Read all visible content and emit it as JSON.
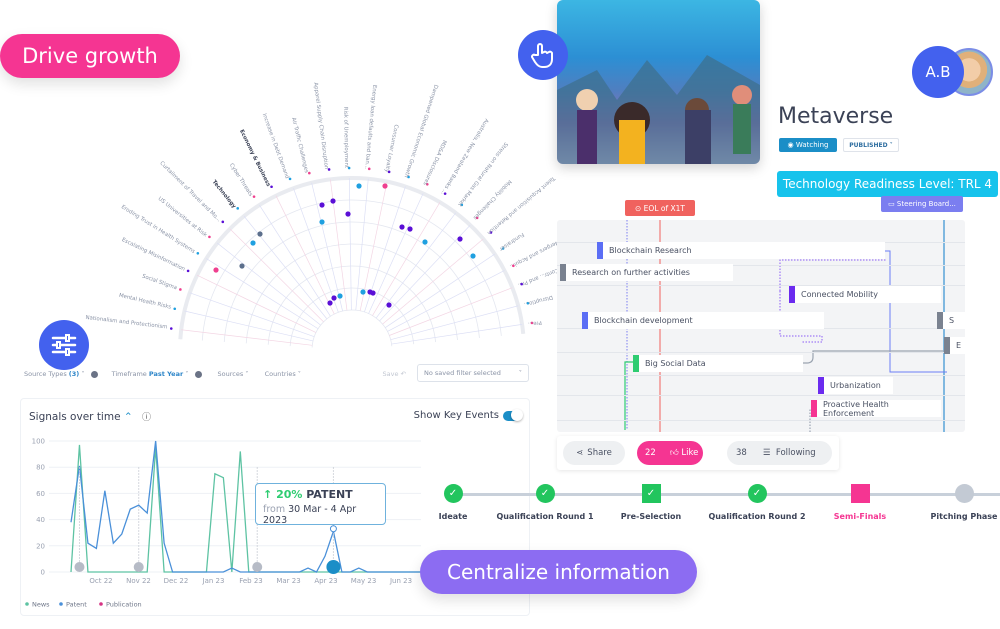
{
  "hero_labels": {
    "drive_growth": "Drive growth",
    "centralize_information": "Centralize information"
  },
  "icons": {
    "hand_pointer": "hand-pointer-icon",
    "sliders": "sliders-icon"
  },
  "radar": {
    "categories": [
      {
        "label": "Technology",
        "bold": true
      },
      {
        "label": "Economy & Business",
        "bold": true
      }
    ],
    "spokes": [
      "Nationalism and Protectionism",
      "Mental Health Risks",
      "Social Stigma",
      "Escalating Misinformation",
      "Eroding Trust in Health Systems",
      "US Universities at Risk",
      "Curtailment of Travel and Mo...",
      "Technology",
      "Cyber Threats",
      "Economy & Business",
      "Increase in Debt Demand",
      "Air Traffic Challenges",
      "Apparel Supply Chain Disruption",
      "Risk of Unemployment",
      "Energy loan defaults and ban...",
      "Consumer Loyalty",
      "Dampened Global Economic Growth",
      "MD&A Disclosures",
      "Australia, New Zealand Banks ...",
      "Stress on Natural Gas Market",
      "Mobility Challenges",
      "Talent Acquisition and Retention",
      "Fundraiser",
      "Hindered Mergers and Acqui...",
      "Cancelled Contr... and Pr...",
      "Disruptio...",
      "Pre..."
    ],
    "colors": {
      "purple": "#5a0fd6",
      "blue": "#1fa0e0",
      "pink": "#ef3f8f",
      "slate": "#5c6f8c"
    }
  },
  "filters": {
    "source_types_label": "Source Types",
    "source_types_count": "(3)",
    "timeframe_label": "Timeframe",
    "timeframe_value": "Past Year",
    "sources_label": "Sources",
    "countries_label": "Countries",
    "save_label": "Save",
    "saved_filter_placeholder": "No saved filter selected"
  },
  "signals": {
    "title": "Signals over time",
    "show_key_events_label": "Show Key Events",
    "show_key_events_on": true,
    "tooltip": {
      "change": "20%",
      "series": "PATENT",
      "from_label": "from",
      "range": "30 Mar - 4 Apr 2023"
    }
  },
  "chart_data": {
    "type": "line",
    "title": "Signals over time",
    "xlabel": "",
    "ylabel": "",
    "ylim": [
      0,
      100
    ],
    "yticks": [
      0,
      20,
      40,
      60,
      80,
      100
    ],
    "xtick_labels": [
      "Oct 22",
      "Nov 22",
      "Dec 22",
      "Jan 23",
      "Feb 23",
      "Mar 23",
      "Apr 23",
      "May 23",
      "Jun 23"
    ],
    "grid": true,
    "legend": [
      "News",
      "Patent",
      "Publication"
    ],
    "legend_position": "bottom-left",
    "colors": {
      "News": "#5ec3a3",
      "Patent": "#4a90d9",
      "Publication": "#d63384"
    },
    "x_weeks": [
      0,
      1,
      2,
      3,
      4,
      5,
      6,
      7,
      8,
      9,
      10,
      11,
      12,
      13,
      14,
      15,
      16,
      17,
      18,
      19,
      20,
      21,
      22,
      23,
      24,
      25,
      26,
      27,
      28,
      29,
      30,
      31,
      32,
      33,
      34,
      35,
      36,
      37,
      38,
      39,
      40,
      41,
      42,
      43
    ],
    "series": [
      {
        "name": "News",
        "values": [
          0,
          97,
          0,
          0,
          0,
          0,
          0,
          0,
          0,
          0,
          95,
          0,
          0,
          0,
          0,
          0,
          0,
          75,
          72,
          0,
          92,
          0,
          0,
          0,
          0,
          0,
          0,
          0,
          0,
          0,
          0,
          0,
          0,
          0,
          0,
          0,
          0,
          0,
          0,
          0,
          0,
          0,
          0,
          0
        ]
      },
      {
        "name": "Patent",
        "values": [
          38,
          81,
          22,
          18,
          62,
          22,
          29,
          48,
          51,
          45,
          100,
          22,
          0,
          0,
          0,
          0,
          0,
          0,
          0,
          3,
          0,
          0,
          0,
          0,
          0,
          0,
          0,
          0,
          3,
          0,
          12,
          31,
          0,
          0,
          3,
          0,
          0,
          0,
          0,
          0,
          0,
          0,
          0,
          0
        ]
      },
      {
        "name": "Publication",
        "values": []
      }
    ],
    "key_event_weeks": [
      1,
      8,
      22,
      31
    ]
  },
  "project": {
    "title": "Metaverse",
    "watching_label": "Watching",
    "status_label": "PUBLISHED",
    "trl_label": "Technology Readiness Level: TRL 4",
    "avatar_initials": "A.B"
  },
  "gantt": {
    "milestones": [
      {
        "label": "EOL of X1T",
        "color": "#f0625e"
      },
      {
        "label": "Steering Board...",
        "color": "#7b7ef0"
      }
    ],
    "items": [
      {
        "label": "Blockchain Research",
        "color": "#5b6ef5"
      },
      {
        "label": "Research on further activities",
        "color": "#7a8290"
      },
      {
        "label": "Connected Mobility",
        "color": "#6b2bef"
      },
      {
        "label": "Blockchain development",
        "color": "#5b6ef5"
      },
      {
        "label": "Big Social Data",
        "color": "#2ecc71"
      },
      {
        "label": "Urbanization",
        "color": "#6b2bef"
      },
      {
        "label": "Proactive Health Enforcement",
        "color": "#f53592"
      },
      {
        "label": "S",
        "color": "#7a8290"
      },
      {
        "label": "E",
        "color": "#7a8290"
      }
    ]
  },
  "actions": {
    "share_label": "Share",
    "like_count": "22",
    "like_label": "Like",
    "follow_count": "38",
    "follow_label": "Following"
  },
  "stages": [
    {
      "label": "Ideate",
      "state": "done",
      "shape": "circle"
    },
    {
      "label": "Qualification Round 1",
      "state": "done",
      "shape": "circle"
    },
    {
      "label": "Pre-Selection",
      "state": "done",
      "shape": "square"
    },
    {
      "label": "Qualification Round 2",
      "state": "done",
      "shape": "circle"
    },
    {
      "label": "Semi-Finals",
      "state": "current",
      "shape": "square"
    },
    {
      "label": "Pitching Phase",
      "state": "pending",
      "shape": "circle"
    }
  ]
}
